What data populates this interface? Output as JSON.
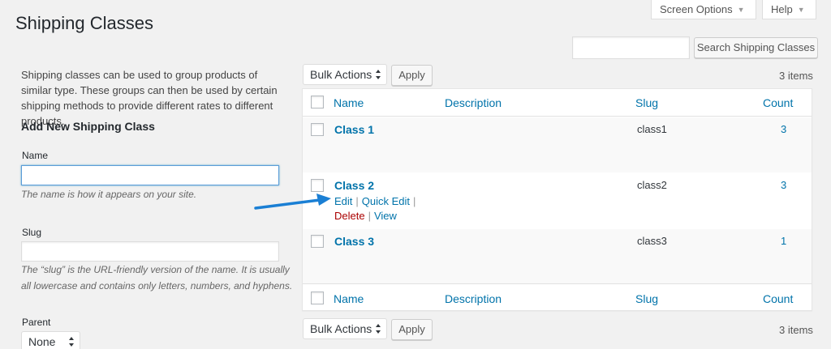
{
  "header": {
    "title": "Shipping Classes",
    "screen_options": "Screen Options",
    "help": "Help"
  },
  "search": {
    "value": "",
    "button": "Search Shipping Classes"
  },
  "form": {
    "description": "Shipping classes can be used to group products of similar type. These groups can then be used by certain shipping methods to provide different rates to different products.",
    "heading": "Add New Shipping Class",
    "name_label": "Name",
    "name_value": "",
    "name_help": "The name is how it appears on your site.",
    "slug_label": "Slug",
    "slug_value": "",
    "slug_help": "The “slug” is the URL-friendly version of the name. It is usually all lowercase and contains only letters, numbers, and hyphens.",
    "parent_label": "Parent",
    "parent_value": "None"
  },
  "tablenav": {
    "bulk_actions": "Bulk Actions",
    "apply": "Apply",
    "items_count": "3 items"
  },
  "table": {
    "columns": [
      "Name",
      "Description",
      "Slug",
      "Count"
    ],
    "rows": [
      {
        "name": "Class 1",
        "description": "",
        "slug": "class1",
        "count": "3"
      },
      {
        "name": "Class 2",
        "description": "",
        "slug": "class2",
        "count": "3"
      },
      {
        "name": "Class 3",
        "description": "",
        "slug": "class3",
        "count": "1"
      }
    ],
    "row_actions": {
      "edit": "Edit",
      "quick_edit": "Quick Edit",
      "delete": "Delete",
      "view": "View",
      "separator": "|"
    }
  },
  "colors": {
    "link": "#0073aa",
    "delete": "#aa0000",
    "annotation_arrow": "#1a7fd4"
  },
  "icons": [
    "dropdown-triangle-icon",
    "select-updown-icon",
    "annotation-arrow-icon"
  ]
}
